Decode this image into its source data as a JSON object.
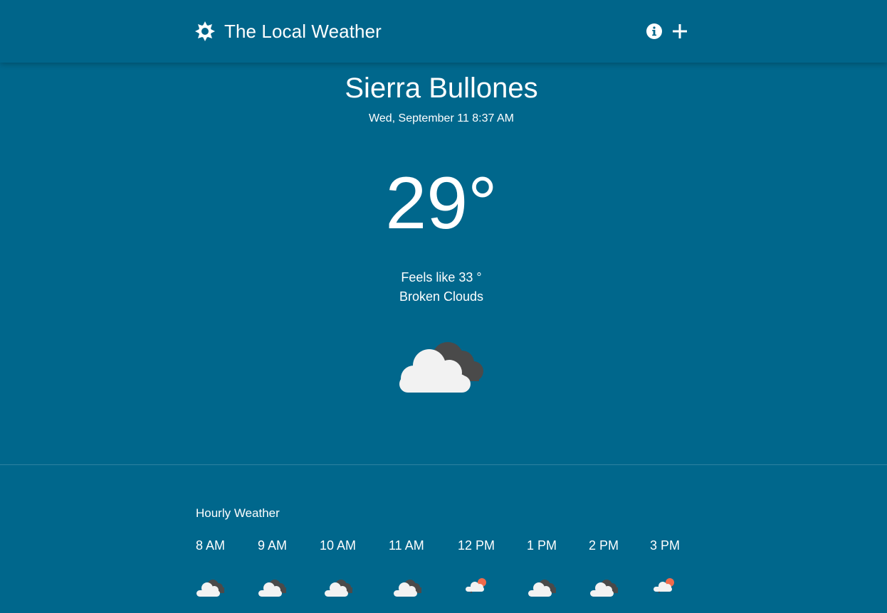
{
  "app": {
    "title": "The Local Weather",
    "logo_icon": "sun-icon",
    "actions": [
      {
        "name": "info-icon"
      },
      {
        "name": "plus-icon"
      }
    ]
  },
  "current": {
    "location": "Sierra Bullones",
    "datetime": "Wed, September 11 8:37 AM",
    "temperature": "29°",
    "feels_like": "Feels like 33 °",
    "description": "Broken Clouds",
    "icon": "broken-clouds-icon"
  },
  "hourly": {
    "title": "Hourly Weather",
    "items": [
      {
        "time": "8 AM",
        "icon": "broken-clouds-icon"
      },
      {
        "time": "9 AM",
        "icon": "broken-clouds-icon"
      },
      {
        "time": "10 AM",
        "icon": "broken-clouds-icon"
      },
      {
        "time": "11 AM",
        "icon": "broken-clouds-icon"
      },
      {
        "time": "12 PM",
        "icon": "partly-cloudy-icon"
      },
      {
        "time": "1 PM",
        "icon": "broken-clouds-icon"
      },
      {
        "time": "2 PM",
        "icon": "broken-clouds-icon"
      },
      {
        "time": "3 PM",
        "icon": "partly-cloudy-icon"
      }
    ]
  },
  "colors": {
    "background": "#00678c",
    "header": "#00658a",
    "cloud_light": "#f2f2f2",
    "cloud_dark": "#4a4a4a",
    "sun": "#ef6a4b",
    "text": "#ffffff"
  }
}
